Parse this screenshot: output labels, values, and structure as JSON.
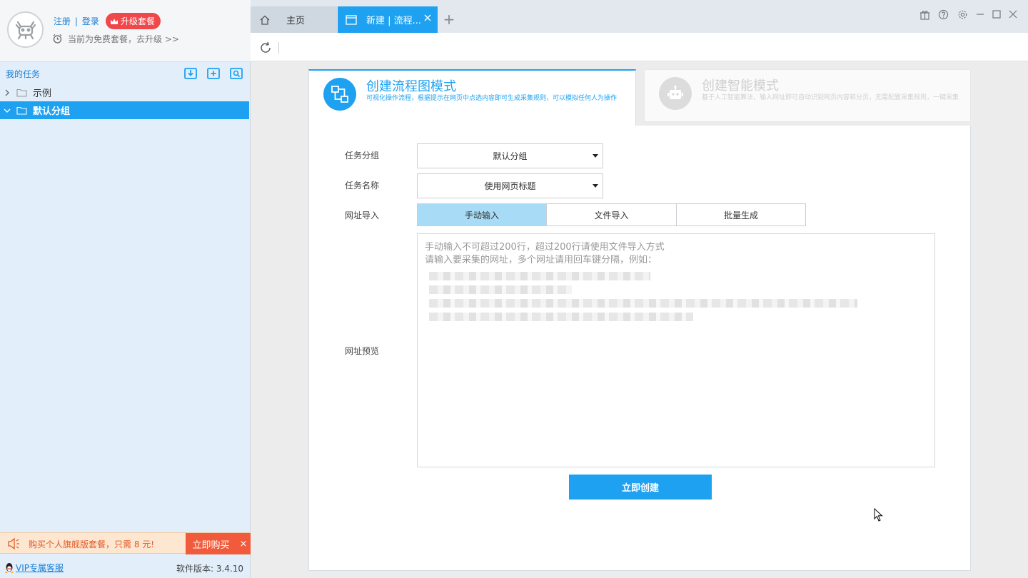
{
  "user": {
    "register_label": "注册",
    "separator": "|",
    "login_label": "登录",
    "upgrade_label": "升级套餐",
    "plan_status": "当前为免费套餐，去升级 >>"
  },
  "tasks": {
    "title": "我的任务",
    "icons": [
      "import-icon",
      "add-task-icon",
      "search-task-icon"
    ],
    "items": [
      {
        "label": "示例",
        "expanded": false,
        "selected": false
      },
      {
        "label": "默认分组",
        "expanded": true,
        "selected": true
      }
    ]
  },
  "promo": {
    "text": "购买个人旗舰版套餐，只需 8 元!",
    "buy_label": "立即购买",
    "close_label": "×"
  },
  "footer": {
    "vip_label": "VIP专属客服",
    "version_label": "软件版本: 3.4.10"
  },
  "tabs": [
    {
      "label": "主页",
      "icon": "home-icon",
      "active": false
    },
    {
      "label": "新建 | 流程...",
      "icon": "window-icon",
      "active": true
    }
  ],
  "tab_add_label": "+",
  "window_controls": [
    "gift-icon",
    "help-icon",
    "settings-icon",
    "minimize-icon",
    "maximize-icon",
    "close-icon"
  ],
  "modes": [
    {
      "title": "创建流程图模式",
      "desc": "可视化操作流程，根据提示在网页中点选内容即可生成采集规则，可以模拟任何人为操作",
      "active": true
    },
    {
      "title": "创建智能模式",
      "desc": "基于人工智能算法，输入网址即可自动识别网页内容和分页，无需配置采集规则，一键采集",
      "active": false
    }
  ],
  "form": {
    "group_label": "任务分组",
    "group_value": "默认分组",
    "name_label": "任务名称",
    "name_value": "使用网页标题",
    "url_import_label": "网址导入",
    "url_import_options": [
      "手动输入",
      "文件导入",
      "批量生成"
    ],
    "url_import_selected": "手动输入",
    "preview_label": "网址预览",
    "placeholder_line1": "手动输入不可超过200行，超过200行请使用文件导入方式",
    "placeholder_line2": "请输入要采集的网址，多个网址请用回车键分隔，例如：",
    "create_label": "立即创建"
  },
  "colors": {
    "accent": "#1ea1f1",
    "upgrade": "#f0474b",
    "promo_bg": "#fde7d0",
    "promo_buy": "#f15a3a",
    "link": "#1a7fd4"
  }
}
